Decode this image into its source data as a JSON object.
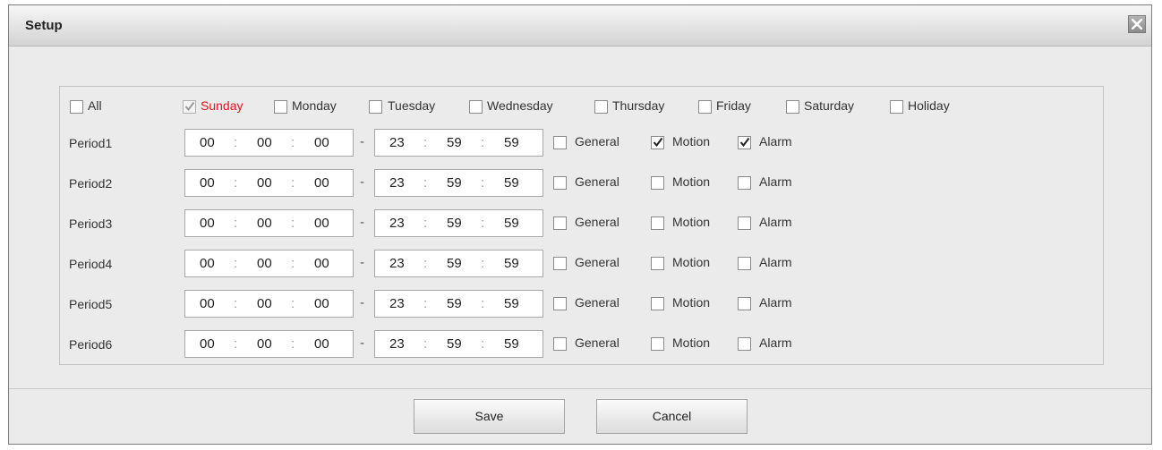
{
  "dialog": {
    "title": "Setup"
  },
  "days": [
    {
      "label": "All",
      "checked": false,
      "disabled": false,
      "active": false
    },
    {
      "label": "Sunday",
      "checked": true,
      "disabled": true,
      "active": true
    },
    {
      "label": "Monday",
      "checked": false,
      "disabled": false,
      "active": false
    },
    {
      "label": "Tuesday",
      "checked": false,
      "disabled": false,
      "active": false
    },
    {
      "label": "Wednesday",
      "checked": false,
      "disabled": false,
      "active": false
    },
    {
      "label": "Thursday",
      "checked": false,
      "disabled": false,
      "active": false
    },
    {
      "label": "Friday",
      "checked": false,
      "disabled": false,
      "active": false
    },
    {
      "label": "Saturday",
      "checked": false,
      "disabled": false,
      "active": false
    },
    {
      "label": "Holiday",
      "checked": false,
      "disabled": false,
      "active": false
    }
  ],
  "time_separator": ":",
  "range_separator": "-",
  "event_types": [
    "General",
    "Motion",
    "Alarm"
  ],
  "periods": [
    {
      "label": "Period1",
      "start": [
        "00",
        "00",
        "00"
      ],
      "end": [
        "23",
        "59",
        "59"
      ],
      "general": false,
      "motion": true,
      "alarm": true
    },
    {
      "label": "Period2",
      "start": [
        "00",
        "00",
        "00"
      ],
      "end": [
        "23",
        "59",
        "59"
      ],
      "general": false,
      "motion": false,
      "alarm": false
    },
    {
      "label": "Period3",
      "start": [
        "00",
        "00",
        "00"
      ],
      "end": [
        "23",
        "59",
        "59"
      ],
      "general": false,
      "motion": false,
      "alarm": false
    },
    {
      "label": "Period4",
      "start": [
        "00",
        "00",
        "00"
      ],
      "end": [
        "23",
        "59",
        "59"
      ],
      "general": false,
      "motion": false,
      "alarm": false
    },
    {
      "label": "Period5",
      "start": [
        "00",
        "00",
        "00"
      ],
      "end": [
        "23",
        "59",
        "59"
      ],
      "general": false,
      "motion": false,
      "alarm": false
    },
    {
      "label": "Period6",
      "start": [
        "00",
        "00",
        "00"
      ],
      "end": [
        "23",
        "59",
        "59"
      ],
      "general": false,
      "motion": false,
      "alarm": false
    }
  ],
  "buttons": {
    "save": "Save",
    "cancel": "Cancel"
  },
  "colors": {
    "active_day": "#e8141a",
    "check": "#222222",
    "check_disabled": "#9a9a9a"
  },
  "icons": {
    "close": "close-icon",
    "check": "checkmark-icon"
  }
}
